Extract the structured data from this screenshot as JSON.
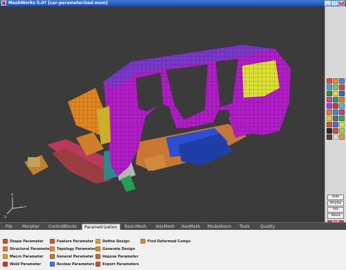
{
  "title": "MeshWorks 5.0? [car-parameterized.msm]",
  "window_buttons": {
    "minimize": "_",
    "maximize": "□",
    "close": "×"
  },
  "axis": {
    "x": "X",
    "y": "Y",
    "z": "Z"
  },
  "side_buttons": {
    "hide": "Hide",
    "display": "Display",
    "adv": "Adv",
    "about": "About",
    "quit": "Quit"
  },
  "tabs": [
    "File",
    "Morpher",
    "ControlBlocks",
    "Parametrization",
    "BasicMesh",
    "AdvMesh",
    "HexMesh",
    "ModelAssm",
    "Tools",
    "Quality"
  ],
  "active_tab": "Parametrization",
  "commands": {
    "shape_parameter": "Shape Parameter",
    "structural_parameter": "Structural Parameter",
    "macro_parameter": "Macro Parameter",
    "weld_parameter": "Weld Parameter",
    "feature_parameter": "Feature Parameter",
    "topology_parameter": "Topology Parameter",
    "general_parameter": "General Parameter",
    "review_parameters": "Review Parameters",
    "define_design": "Define Design",
    "generate_design": "Generate Design",
    "impose_parameter": "Impose Parameter",
    "export_parameters": "Export Parameters",
    "find_deformed_comps": "Find Deformed Comps"
  },
  "colors": {
    "viewport_bg": "#3b3b3b",
    "body_magenta": "#b01cc6",
    "roof_purple": "#7a38c8",
    "front_orange": "#e3861f",
    "window_yellow": "#dbe033",
    "floor_blue": "#2a4fd0",
    "frame_red": "#b83a5a",
    "quit_red": "#e02a2a"
  }
}
